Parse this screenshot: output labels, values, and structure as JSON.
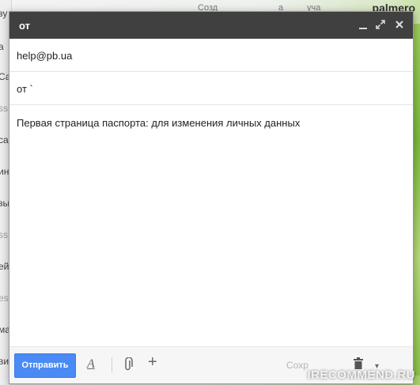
{
  "background": {
    "top_text_left": "Созд",
    "top_text_mid": "а",
    "top_text_right": "уча",
    "user": "palmero",
    "left_fragments": [
      "зу",
      "а",
      "Са",
      "ss",
      "са",
      "ин",
      "зы",
      "ss",
      "ей",
      "es",
      "ма",
      "ви"
    ]
  },
  "compose": {
    "title": "от",
    "to": "help@pb.ua",
    "subject": "от `",
    "body": "Первая страница паспорта: для изменения личных данных",
    "send_label": "Отправить",
    "saved_label": "Сохр"
  },
  "watermark": "IRECOMMEND.RU",
  "colors": {
    "titlebar": "#404040",
    "send_button": "#4a8af4"
  }
}
